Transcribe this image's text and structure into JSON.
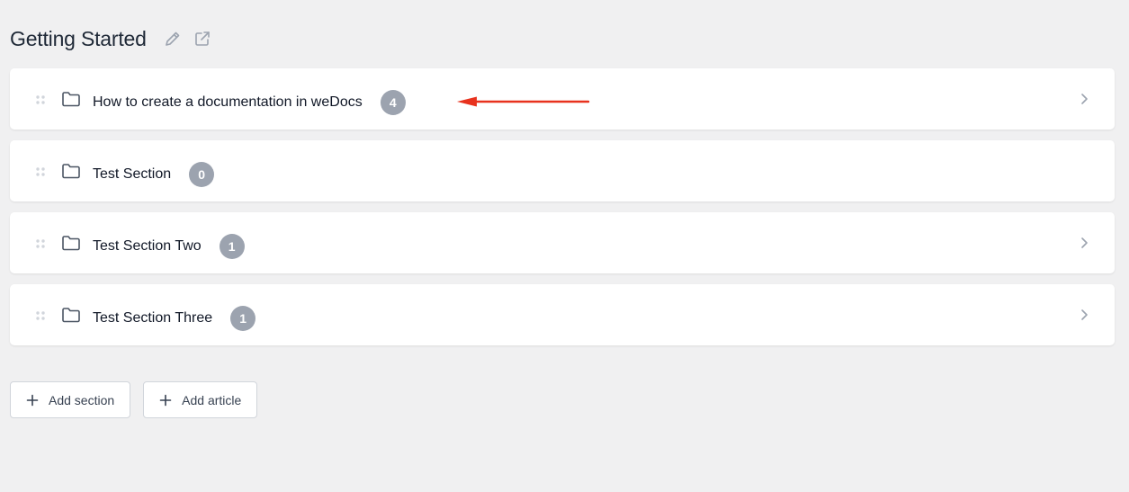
{
  "header": {
    "title": "Getting Started",
    "edit_icon": "pencil-icon",
    "external_icon": "external-link-icon"
  },
  "sections": [
    {
      "title": "How to create a documentation in weDocs",
      "count": "4",
      "expandable": true
    },
    {
      "title": "Test Section",
      "count": "0",
      "expandable": false
    },
    {
      "title": "Test Section Two",
      "count": "1",
      "expandable": true
    },
    {
      "title": "Test Section Three",
      "count": "1",
      "expandable": true
    }
  ],
  "actions": {
    "add_section_label": "Add section",
    "add_article_label": "Add article"
  },
  "colors": {
    "background": "#f0f0f1",
    "badge": "#9ca3af",
    "annotation_arrow": "#e8321e"
  }
}
